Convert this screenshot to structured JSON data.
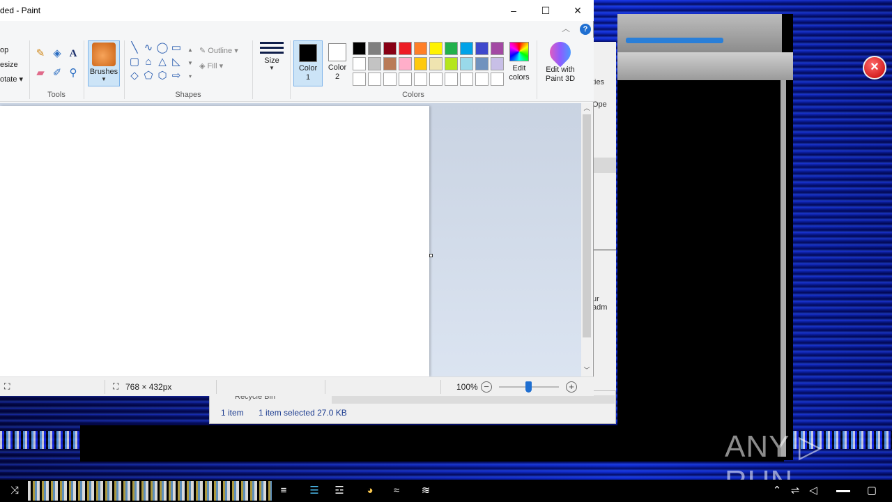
{
  "window": {
    "title": "ded - Paint",
    "minimize": "–",
    "maximize": "☐",
    "close": "✕",
    "help": "?"
  },
  "ribbon": {
    "image_items": [
      "op",
      "esize",
      "otate ▾"
    ],
    "tools_label": "Tools",
    "brushes_label": "Brushes",
    "shapes_label": "Shapes",
    "outline_label": "Outline",
    "fill_label": "Fill",
    "size_label": "Size",
    "color1_label": [
      "Color",
      "1"
    ],
    "color2_label": [
      "Color",
      "2"
    ],
    "colors_label": "Colors",
    "edit_colors_label": [
      "Edit",
      "colors"
    ],
    "paint3d_label": [
      "Edit with",
      "Paint 3D"
    ]
  },
  "palette": {
    "row1": [
      "#000000",
      "#7f7f7f",
      "#880015",
      "#ed1c24",
      "#ff7f27",
      "#fff200",
      "#22b14c",
      "#00a2e8",
      "#3f48cc",
      "#a349a4"
    ],
    "row2": [
      "#ffffff",
      "#c3c3c3",
      "#b97a57",
      "#ffaec9",
      "#ffc90e",
      "#efe4b0",
      "#b5e61d",
      "#99d9ea",
      "#7092be",
      "#c8bfe7"
    ],
    "row3": [
      "#ffffff",
      "#ffffff",
      "#ffffff",
      "#ffffff",
      "#ffffff",
      "#ffffff",
      "#ffffff",
      "#ffffff",
      "#ffffff",
      "#ffffff"
    ],
    "color1": "#000000",
    "color2": "#ffffff"
  },
  "status": {
    "dimensions": "768 × 432px",
    "zoom": "100%"
  },
  "explorer": {
    "address_fragment": "Recycle Bin",
    "item_count": "1 item",
    "selection": "1 item selected  27.0 KB",
    "side_text_1": "ties",
    "side_text_2": "Ope",
    "side_text_3": "ur adm"
  },
  "watermark": "ANY ▷ RUN"
}
